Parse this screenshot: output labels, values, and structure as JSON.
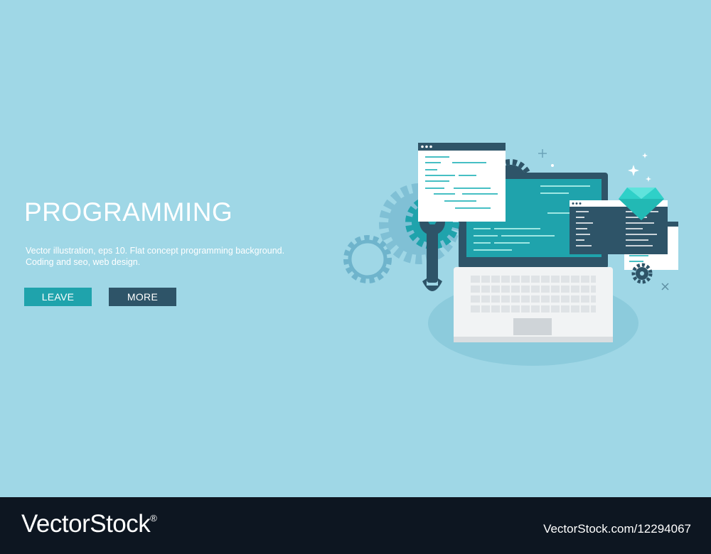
{
  "banner": {
    "headline": "PROGRAMMING",
    "description_line1": "Vector illustration, eps 10. Flat concept programming background.",
    "description_line2": "Coding and seo, web design.",
    "leave_label": "LEAVE",
    "more_label": "MORE"
  },
  "footer": {
    "brand_name": "VectorStock",
    "brand_mark": "®",
    "stock_id": "VectorStock.com/12294067"
  },
  "colors": {
    "background": "#9fd7e6",
    "leave_button": "#1fa3ac",
    "more_button": "#2e5468",
    "footer_bar": "#0d1621",
    "gem": "#2fd0c8"
  },
  "icons": [
    "laptop-icon",
    "gear-icon",
    "wrench-icon",
    "code-window-icon",
    "diamond-gem-icon",
    "sparkle-icon",
    "plus-icon",
    "close-icon"
  ]
}
